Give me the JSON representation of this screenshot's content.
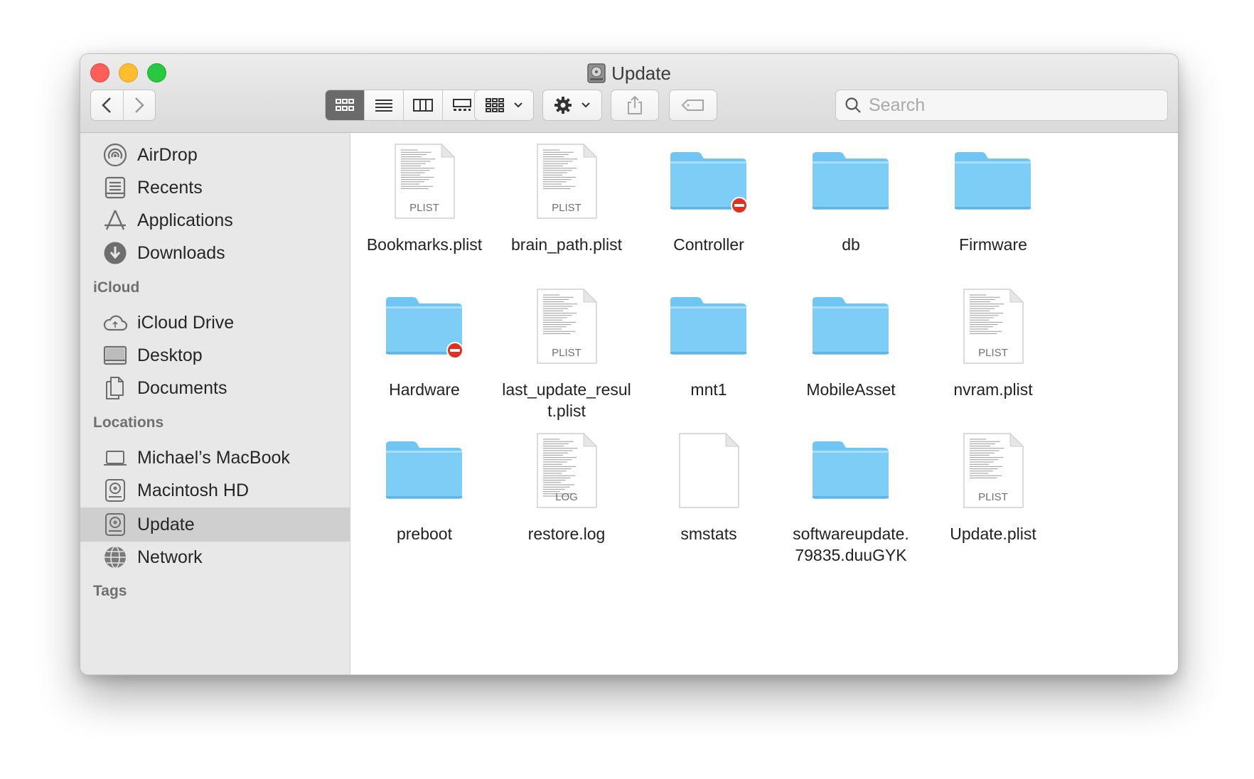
{
  "window": {
    "title": "Update"
  },
  "toolbar": {
    "search_placeholder": "Search"
  },
  "sidebar": {
    "favorites": [
      {
        "label": "AirDrop",
        "icon": "airdrop-icon"
      },
      {
        "label": "Recents",
        "icon": "recents-icon"
      },
      {
        "label": "Applications",
        "icon": "applications-icon"
      },
      {
        "label": "Downloads",
        "icon": "downloads-icon"
      }
    ],
    "icloud_header": "iCloud",
    "icloud": [
      {
        "label": "iCloud Drive",
        "icon": "icloud-drive-icon"
      },
      {
        "label": "Desktop",
        "icon": "desktop-icon"
      },
      {
        "label": "Documents",
        "icon": "documents-icon"
      }
    ],
    "locations_header": "Locations",
    "locations": [
      {
        "label": "Michael’s MacBook",
        "icon": "laptop-icon"
      },
      {
        "label": "Macintosh HD",
        "icon": "hard-drive-icon"
      },
      {
        "label": "Update",
        "icon": "hard-drive-icon",
        "selected": true
      },
      {
        "label": "Network",
        "icon": "network-icon"
      }
    ],
    "tags_header": "Tags"
  },
  "files": [
    {
      "name": "Bookmarks.plist",
      "kind": "plist",
      "badge": "PLIST"
    },
    {
      "name": "brain_path.plist",
      "kind": "plist",
      "badge": "PLIST"
    },
    {
      "name": "Controller",
      "kind": "folder",
      "restricted": true
    },
    {
      "name": "db",
      "kind": "folder"
    },
    {
      "name": "Firmware",
      "kind": "folder"
    },
    {
      "name": "Hardware",
      "kind": "folder",
      "restricted": true
    },
    {
      "name": "last_update_result.plist",
      "kind": "plist",
      "badge": "PLIST"
    },
    {
      "name": "mnt1",
      "kind": "folder"
    },
    {
      "name": "MobileAsset",
      "kind": "folder"
    },
    {
      "name": "nvram.plist",
      "kind": "plist",
      "badge": "PLIST"
    },
    {
      "name": "preboot",
      "kind": "folder"
    },
    {
      "name": "restore.log",
      "kind": "log",
      "badge": "LOG"
    },
    {
      "name": "smstats",
      "kind": "blank"
    },
    {
      "name": "softwareupdate.79835.duuGYK",
      "kind": "folder"
    },
    {
      "name": "Update.plist",
      "kind": "plist",
      "badge": "PLIST"
    }
  ],
  "colors": {
    "folder": "#6fc6f5",
    "close": "#ff5f57",
    "minimize": "#febc2e",
    "zoom": "#28c840",
    "restricted": "#e0301e"
  }
}
